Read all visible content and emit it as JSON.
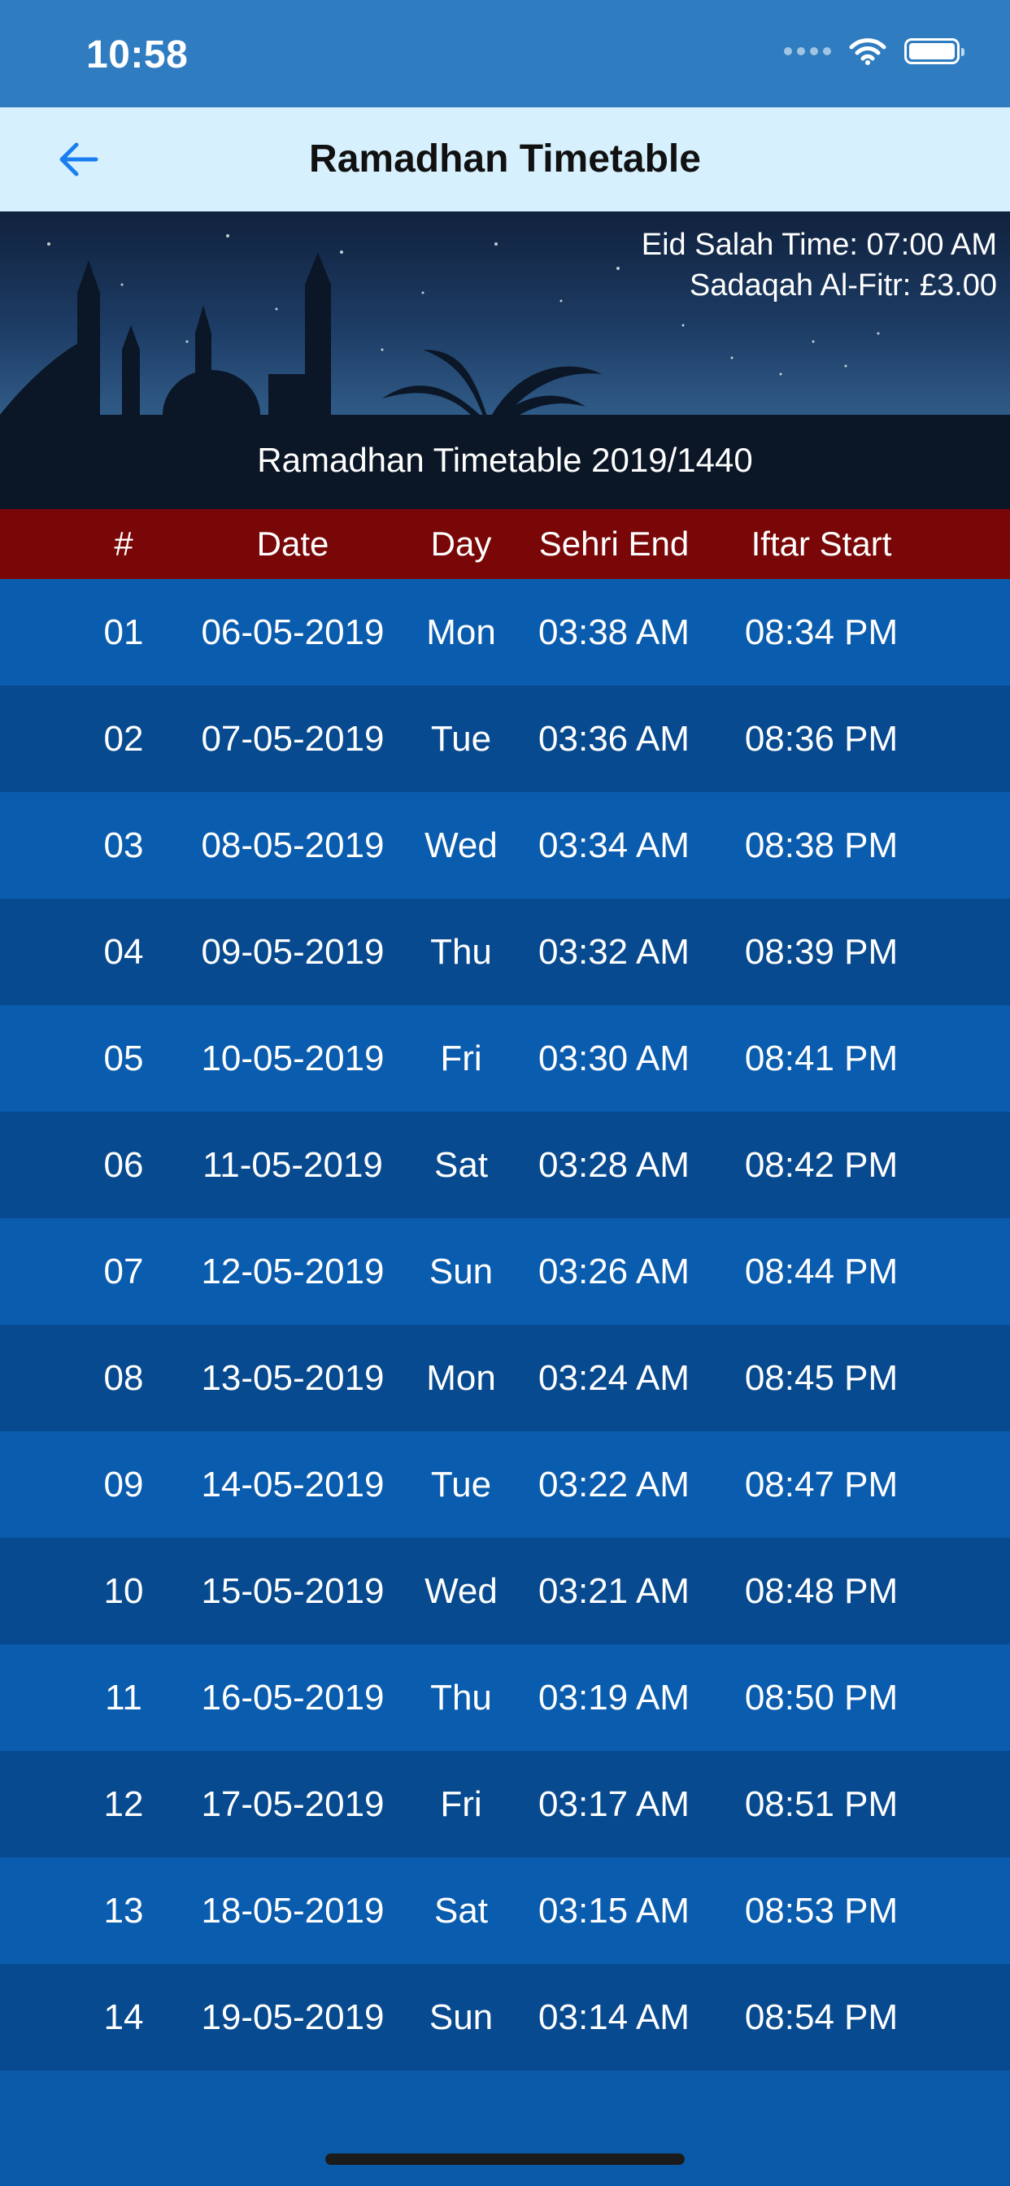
{
  "status_bar": {
    "time": "10:58"
  },
  "nav": {
    "title": "Ramadhan Timetable"
  },
  "banner": {
    "eid_salah": "Eid Salah Time: 07:00 AM",
    "sadaqah": "Sadaqah Al-Fitr: £3.00",
    "title": "Ramadhan Timetable 2019/1440"
  },
  "table": {
    "headers": {
      "num": "#",
      "date": "Date",
      "day": "Day",
      "sehri": "Sehri End",
      "iftar": "Iftar Start"
    },
    "rows": [
      {
        "num": "01",
        "date": "06-05-2019",
        "day": "Mon",
        "sehri": "03:38 AM",
        "iftar": "08:34 PM"
      },
      {
        "num": "02",
        "date": "07-05-2019",
        "day": "Tue",
        "sehri": "03:36 AM",
        "iftar": "08:36 PM"
      },
      {
        "num": "03",
        "date": "08-05-2019",
        "day": "Wed",
        "sehri": "03:34 AM",
        "iftar": "08:38 PM"
      },
      {
        "num": "04",
        "date": "09-05-2019",
        "day": "Thu",
        "sehri": "03:32 AM",
        "iftar": "08:39 PM"
      },
      {
        "num": "05",
        "date": "10-05-2019",
        "day": "Fri",
        "sehri": "03:30 AM",
        "iftar": "08:41 PM"
      },
      {
        "num": "06",
        "date": "11-05-2019",
        "day": "Sat",
        "sehri": "03:28 AM",
        "iftar": "08:42 PM"
      },
      {
        "num": "07",
        "date": "12-05-2019",
        "day": "Sun",
        "sehri": "03:26 AM",
        "iftar": "08:44 PM"
      },
      {
        "num": "08",
        "date": "13-05-2019",
        "day": "Mon",
        "sehri": "03:24 AM",
        "iftar": "08:45 PM"
      },
      {
        "num": "09",
        "date": "14-05-2019",
        "day": "Tue",
        "sehri": "03:22 AM",
        "iftar": "08:47 PM"
      },
      {
        "num": "10",
        "date": "15-05-2019",
        "day": "Wed",
        "sehri": "03:21 AM",
        "iftar": "08:48 PM"
      },
      {
        "num": "11",
        "date": "16-05-2019",
        "day": "Thu",
        "sehri": "03:19 AM",
        "iftar": "08:50 PM"
      },
      {
        "num": "12",
        "date": "17-05-2019",
        "day": "Fri",
        "sehri": "03:17 AM",
        "iftar": "08:51 PM"
      },
      {
        "num": "13",
        "date": "18-05-2019",
        "day": "Sat",
        "sehri": "03:15 AM",
        "iftar": "08:53 PM"
      },
      {
        "num": "14",
        "date": "19-05-2019",
        "day": "Sun",
        "sehri": "03:14 AM",
        "iftar": "08:54 PM"
      }
    ]
  },
  "icons": {
    "back": "arrow-left-icon",
    "wifi": "wifi-icon",
    "battery": "battery-icon",
    "signal": "signal-icon"
  },
  "colors": {
    "status_bar": "#2f7cc0",
    "nav_bar": "#d6f0fd",
    "header_row": "#7a0707",
    "row_light": "#0a5cae",
    "row_dark": "#074a8f",
    "accent": "#1a7ef0"
  }
}
